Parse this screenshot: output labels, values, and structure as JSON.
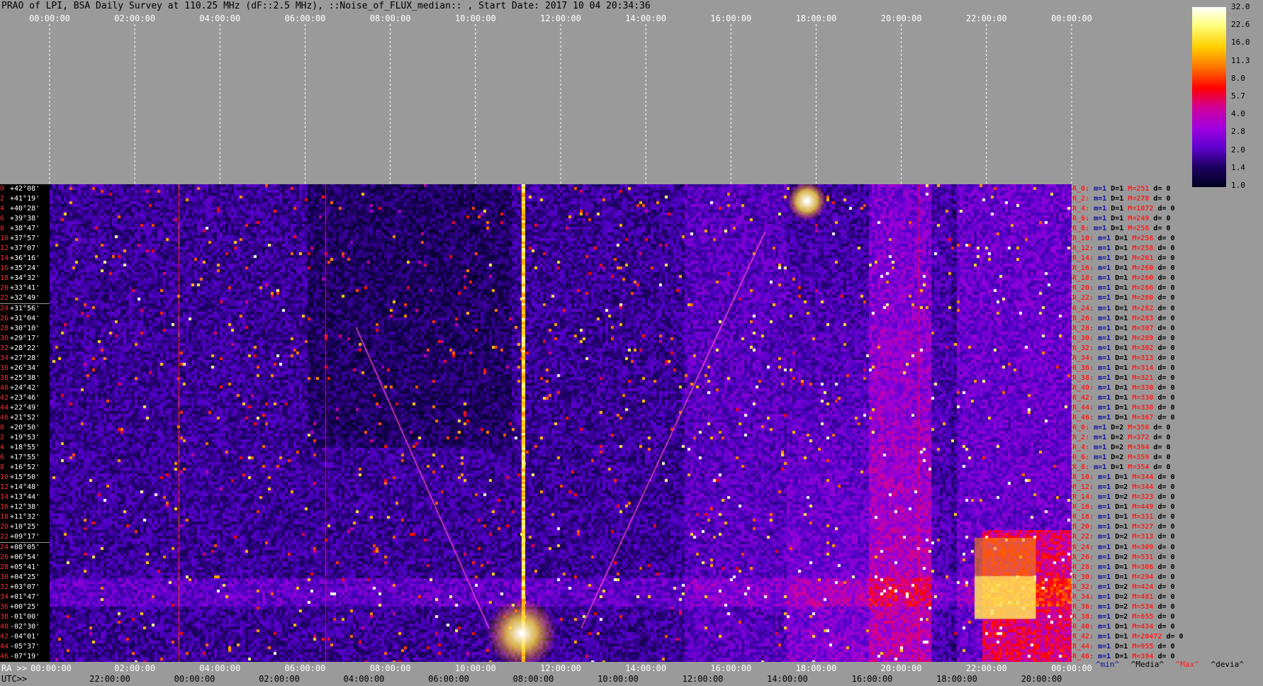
{
  "chart_data": {
    "type": "heatmap",
    "title": "PRAO of LPI, BSA Daily Survey at 110.25 MHz (dF::2.5 MHz), ::Noise_of_FLUX_median:: , Start Date: 2017 10 04 20:34:36",
    "top_ticks": [
      "00:00:00",
      "02:00:00",
      "04:00:00",
      "06:00:00",
      "08:00:00",
      "10:00:00",
      "12:00:00",
      "14:00:00",
      "16:00:00",
      "18:00:00",
      "20:00:00",
      "22:00:00",
      "00:00:00"
    ],
    "ra_label": "RA >>",
    "ra_ticks": [
      "00:00:00",
      "02:00:00",
      "04:00:00",
      "06:00:00",
      "08:00:00",
      "10:00:00",
      "12:00:00",
      "14:00:00",
      "16:00:00",
      "18:00:00",
      "20:00:00",
      "22:00:00",
      "00:00:00"
    ],
    "utc_label": "UTC>>",
    "utc_ticks": [
      "22:00:00",
      "00:00:00",
      "02:00:00",
      "04:00:00",
      "06:00:00",
      "08:00:00",
      "10:00:00",
      "12:00:00",
      "14:00:00",
      "16:00:00",
      "18:00:00",
      "20:00:00"
    ],
    "colorbar_ticks": [
      "32.0",
      "22.6",
      "16.0",
      "11.3",
      "8.0",
      "5.7",
      "4.0",
      "2.8",
      "2.0",
      "1.4",
      "1.0"
    ],
    "declinations": [
      "+42°08'",
      "+41°19'",
      "+40°28'",
      "+39°38'",
      "+38°47'",
      "+37°57'",
      "+37°07'",
      "+36°16'",
      "+35°24'",
      "+34°32'",
      "+33°41'",
      "+32°49'",
      "+31°56'",
      "+31°04'",
      "+30°10'",
      "+29°17'",
      "+28°22'",
      "+27°28'",
      "+26°34'",
      "+25°38'",
      "+24°42'",
      "+23°46'",
      "+22°49'",
      "+21°52'",
      "+20°50'",
      "+19°53'",
      "+18°55'",
      "+17°55'",
      "+16°52'",
      "+15°50'",
      "+14°48'",
      "+13°44'",
      "+12°38'",
      "+11°32'",
      "+10°25'",
      "+09°17'",
      "+08°05'",
      "+06°54'",
      "+05°41'",
      "+04°25'",
      "+03°07'",
      "+01°47'",
      "+00°25'",
      "-01°00'",
      "-02°30'",
      "-04°01'",
      "-05°37'",
      "-07°19'"
    ],
    "row_indices": [
      "0",
      "2",
      "4",
      "6",
      "8",
      "10",
      "12",
      "14",
      "16",
      "18",
      "20",
      "22",
      "24",
      "26",
      "28",
      "30",
      "32",
      "34",
      "36",
      "38",
      "40",
      "42",
      "44",
      "46",
      "0",
      "2",
      "4",
      "6",
      "8",
      "10",
      "12",
      "14",
      "16",
      "18",
      "20",
      "22",
      "24",
      "26",
      "28",
      "30",
      "32",
      "34",
      "36",
      "38",
      "40",
      "42",
      "44",
      "46"
    ],
    "row_stats": [
      {
        "r": "R_0:",
        "m": "m=1",
        "d": "D=1",
        "mx": "M=251",
        "dv": "d= 0"
      },
      {
        "r": "R_2:",
        "m": "m=1",
        "d": "D=1",
        "mx": "M=270",
        "dv": "d= 0"
      },
      {
        "r": "R_4:",
        "m": "m=1",
        "d": "D=1",
        "mx": "M=1072",
        "dv": "d= 0"
      },
      {
        "r": "R_6:",
        "m": "m=1",
        "d": "D=1",
        "mx": "M=249",
        "dv": "d= 0"
      },
      {
        "r": "R_8:",
        "m": "m=1",
        "d": "D=1",
        "mx": "M=256",
        "dv": "d= 0"
      },
      {
        "r": "R_10:",
        "m": "m=1",
        "d": "D=1",
        "mx": "M=258",
        "dv": "d= 0"
      },
      {
        "r": "R_12:",
        "m": "m=1",
        "d": "D=1",
        "mx": "M=258",
        "dv": "d= 0"
      },
      {
        "r": "R_14:",
        "m": "m=1",
        "d": "D=1",
        "mx": "M=261",
        "dv": "d= 0"
      },
      {
        "r": "R_16:",
        "m": "m=1",
        "d": "D=1",
        "mx": "M=260",
        "dv": "d= 0"
      },
      {
        "r": "R_18:",
        "m": "m=1",
        "d": "D=1",
        "mx": "M=260",
        "dv": "d= 0"
      },
      {
        "r": "R_20:",
        "m": "m=1",
        "d": "D=1",
        "mx": "M=266",
        "dv": "d= 0"
      },
      {
        "r": "R_22:",
        "m": "m=1",
        "d": "D=1",
        "mx": "M=280",
        "dv": "d= 0"
      },
      {
        "r": "R_24:",
        "m": "m=1",
        "d": "D=1",
        "mx": "M=282",
        "dv": "d= 0"
      },
      {
        "r": "R_26:",
        "m": "m=1",
        "d": "D=1",
        "mx": "M=283",
        "dv": "d= 0"
      },
      {
        "r": "R_28:",
        "m": "m=1",
        "d": "D=1",
        "mx": "M=307",
        "dv": "d= 0"
      },
      {
        "r": "R_30:",
        "m": "m=1",
        "d": "D=1",
        "mx": "M=289",
        "dv": "d= 0"
      },
      {
        "r": "R_32:",
        "m": "m=1",
        "d": "D=1",
        "mx": "M=302",
        "dv": "d= 0"
      },
      {
        "r": "R_34:",
        "m": "m=1",
        "d": "D=1",
        "mx": "M=313",
        "dv": "d= 0"
      },
      {
        "r": "R_36:",
        "m": "m=1",
        "d": "D=1",
        "mx": "M=314",
        "dv": "d= 0"
      },
      {
        "r": "R_38:",
        "m": "m=1",
        "d": "D=1",
        "mx": "M=321",
        "dv": "d= 0"
      },
      {
        "r": "R_40:",
        "m": "m=1",
        "d": "D=1",
        "mx": "M=330",
        "dv": "d= 0"
      },
      {
        "r": "R_42:",
        "m": "m=1",
        "d": "D=1",
        "mx": "M=330",
        "dv": "d= 0"
      },
      {
        "r": "R_44:",
        "m": "m=1",
        "d": "D=1",
        "mx": "M=330",
        "dv": "d= 0"
      },
      {
        "r": "R_46:",
        "m": "m=1",
        "d": "D=1",
        "mx": "M=367",
        "dv": "d= 0"
      },
      {
        "r": "R_0:",
        "m": "m=1",
        "d": "D=2",
        "mx": "M=356",
        "dv": "d= 0"
      },
      {
        "r": "R_2:",
        "m": "m=1",
        "d": "D=2",
        "mx": "M=372",
        "dv": "d= 0"
      },
      {
        "r": "R_4:",
        "m": "m=1",
        "d": "D=2",
        "mx": "M=394",
        "dv": "d= 0"
      },
      {
        "r": "R_6:",
        "m": "m=1",
        "d": "D=2",
        "mx": "M=359",
        "dv": "d= 0"
      },
      {
        "r": "R_8:",
        "m": "m=1",
        "d": "D=1",
        "mx": "M=354",
        "dv": "d= 0"
      },
      {
        "r": "R_10:",
        "m": "m=1",
        "d": "D=1",
        "mx": "M=344",
        "dv": "d= 0"
      },
      {
        "r": "R_12:",
        "m": "m=1",
        "d": "D=2",
        "mx": "M=344",
        "dv": "d= 0"
      },
      {
        "r": "R_14:",
        "m": "m=1",
        "d": "D=2",
        "mx": "M=323",
        "dv": "d= 0"
      },
      {
        "r": "R_16:",
        "m": "m=1",
        "d": "D=1",
        "mx": "M=449",
        "dv": "d= 0"
      },
      {
        "r": "R_18:",
        "m": "m=1",
        "d": "D=1",
        "mx": "M=331",
        "dv": "d= 0"
      },
      {
        "r": "R_20:",
        "m": "m=1",
        "d": "D=1",
        "mx": "M=327",
        "dv": "d= 0"
      },
      {
        "r": "R_22:",
        "m": "m=1",
        "d": "D=2",
        "mx": "M=313",
        "dv": "d= 0"
      },
      {
        "r": "R_24:",
        "m": "m=1",
        "d": "D=1",
        "mx": "M=309",
        "dv": "d= 0"
      },
      {
        "r": "R_26:",
        "m": "m=1",
        "d": "D=2",
        "mx": "M=531",
        "dv": "d= 0"
      },
      {
        "r": "R_28:",
        "m": "m=1",
        "d": "D=1",
        "mx": "M=306",
        "dv": "d= 0"
      },
      {
        "r": "R_30:",
        "m": "m=1",
        "d": "D=1",
        "mx": "M=294",
        "dv": "d= 0"
      },
      {
        "r": "R_32:",
        "m": "m=1",
        "d": "D=2",
        "mx": "M=424",
        "dv": "d= 0"
      },
      {
        "r": "R_34:",
        "m": "m=1",
        "d": "D=2",
        "mx": "M=481",
        "dv": "d= 0"
      },
      {
        "r": "R_36:",
        "m": "m=1",
        "d": "D=2",
        "mx": "M=534",
        "dv": "d= 0"
      },
      {
        "r": "R_38:",
        "m": "m=1",
        "d": "D=2",
        "mx": "M=655",
        "dv": "d= 0"
      },
      {
        "r": "R_40:",
        "m": "m=1",
        "d": "D=1",
        "mx": "M=434",
        "dv": "d= 0"
      },
      {
        "r": "R_42:",
        "m": "m=1",
        "d": "D=1",
        "mx": "M=20472",
        "dv": "d= 0"
      },
      {
        "r": "R_44:",
        "m": "m=1",
        "d": "D=1",
        "mx": "M=955",
        "dv": "d= 0"
      },
      {
        "r": "R_46:",
        "m": "m=1",
        "d": "D=1",
        "mx": "M=394",
        "dv": "d= 0"
      }
    ],
    "legend": {
      "min": "^min^",
      "median": "^Media^",
      "max": "^Max^",
      "devia": "^devia^"
    },
    "colors": {
      "min": "#1010a0",
      "median": "#000000",
      "max": "#ff2020",
      "devia": "#000000"
    }
  }
}
